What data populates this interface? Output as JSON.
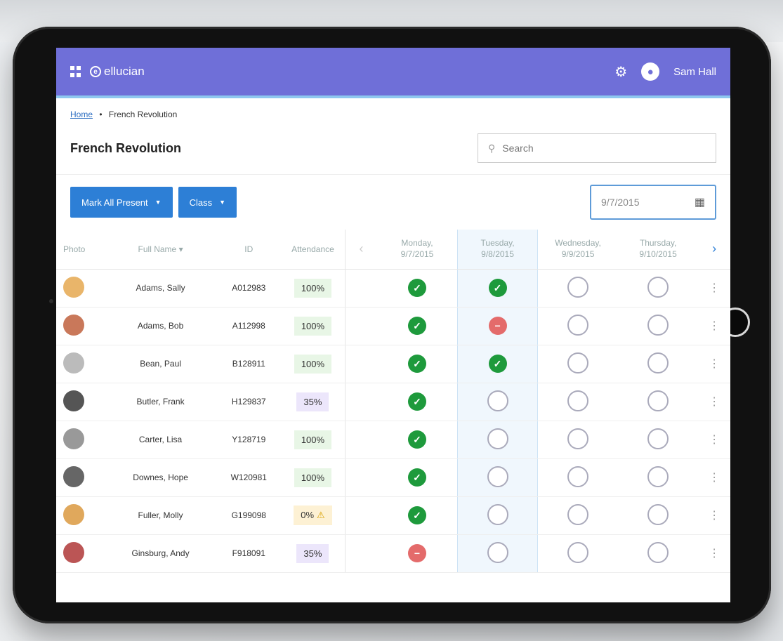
{
  "header": {
    "brand": "ellucian",
    "brand_mark": "e",
    "user_name": "Sam Hall"
  },
  "breadcrumb": {
    "home": "Home",
    "separator": "•",
    "current": "French Revolution"
  },
  "page_title": "French Revolution",
  "search": {
    "placeholder": "Search"
  },
  "toolbar": {
    "mark_all_label": "Mark All Present",
    "class_label": "Class",
    "date_value": "9/7/2015"
  },
  "table": {
    "headers": {
      "photo": "Photo",
      "name": "Full Name",
      "id": "ID",
      "attendance": "Attendance"
    },
    "days": [
      {
        "day": "Monday,",
        "date": "9/7/2015"
      },
      {
        "day": "Tuesday,",
        "date": "9/8/2015"
      },
      {
        "day": "Wednesday,",
        "date": "9/9/2015"
      },
      {
        "day": "Thursday,",
        "date": "9/10/2015"
      }
    ],
    "rows": [
      {
        "name": "Adams, Sally",
        "id": "A012983",
        "attendance": "100%",
        "status": [
          "present",
          "present",
          "empty",
          "empty"
        ]
      },
      {
        "name": "Adams, Bob",
        "id": "A112998",
        "attendance": "100%",
        "status": [
          "present",
          "absent",
          "empty",
          "empty"
        ]
      },
      {
        "name": "Bean, Paul",
        "id": "B128911",
        "attendance": "100%",
        "status": [
          "present",
          "present",
          "empty",
          "empty"
        ]
      },
      {
        "name": "Butler, Frank",
        "id": "H129837",
        "attendance": "35%",
        "status": [
          "present",
          "empty",
          "empty",
          "empty"
        ]
      },
      {
        "name": "Carter, Lisa",
        "id": "Y128719",
        "attendance": "100%",
        "status": [
          "present",
          "empty",
          "empty",
          "empty"
        ]
      },
      {
        "name": "Downes, Hope",
        "id": "W120981",
        "attendance": "100%",
        "status": [
          "present",
          "empty",
          "empty",
          "empty"
        ]
      },
      {
        "name": "Fuller, Molly",
        "id": "G199098",
        "attendance": "0%",
        "status": [
          "present",
          "empty",
          "empty",
          "empty"
        ]
      },
      {
        "name": "Ginsburg, Andy",
        "id": "F918091",
        "attendance": "35%",
        "status": [
          "absent",
          "empty",
          "empty",
          "empty"
        ]
      }
    ]
  },
  "colors": {
    "header": "#6f6fd8",
    "button": "#2d7fd6",
    "present": "#1e9a3c",
    "absent": "#e46b6b"
  }
}
